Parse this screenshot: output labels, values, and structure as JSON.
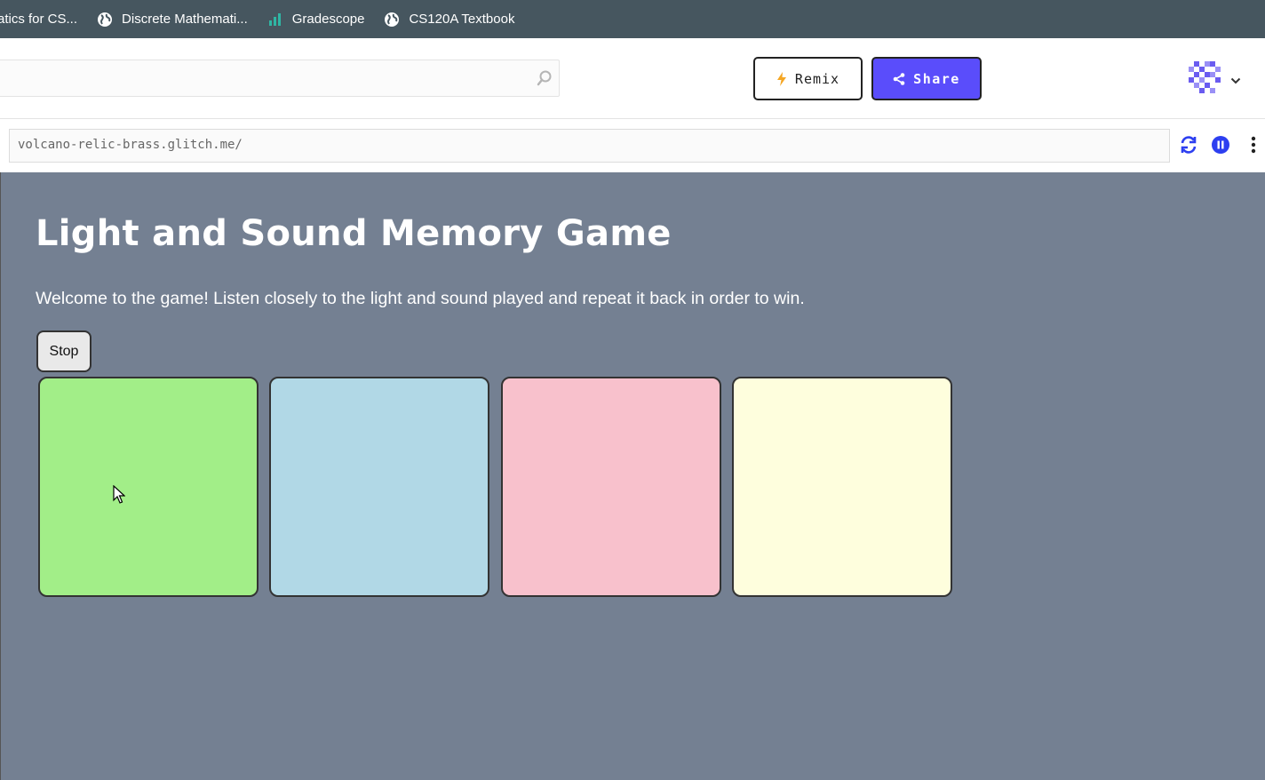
{
  "bookmarks": [
    {
      "label": "atics for CS...",
      "icon": "none"
    },
    {
      "label": "Discrete Mathemati...",
      "icon": "globe-icon"
    },
    {
      "label": "Gradescope",
      "icon": "bar-chart-icon"
    },
    {
      "label": "CS120A Textbook",
      "icon": "globe-icon"
    }
  ],
  "header": {
    "search_placeholder": "",
    "remix_label": "Remix",
    "share_label": "Share"
  },
  "urlbar": {
    "url": "volcano-relic-brass.glitch.me/"
  },
  "app": {
    "title": "Light and Sound Memory Game",
    "description": "Welcome to the game! Listen closely to the light and sound played and repeat it back in order to win.",
    "stop_label": "Stop",
    "buttons": [
      {
        "name": "game-button-1",
        "color": "#a2ee88"
      },
      {
        "name": "game-button-2",
        "color": "#b1d8e6"
      },
      {
        "name": "game-button-3",
        "color": "#f8c1cc"
      },
      {
        "name": "game-button-4",
        "color": "#fefedd"
      }
    ]
  },
  "colors": {
    "bookmarks_bg": "#46565f",
    "share_bg": "#5a4dfb",
    "preview_bg": "#748092",
    "icon_blue": "#2d3ff0"
  }
}
